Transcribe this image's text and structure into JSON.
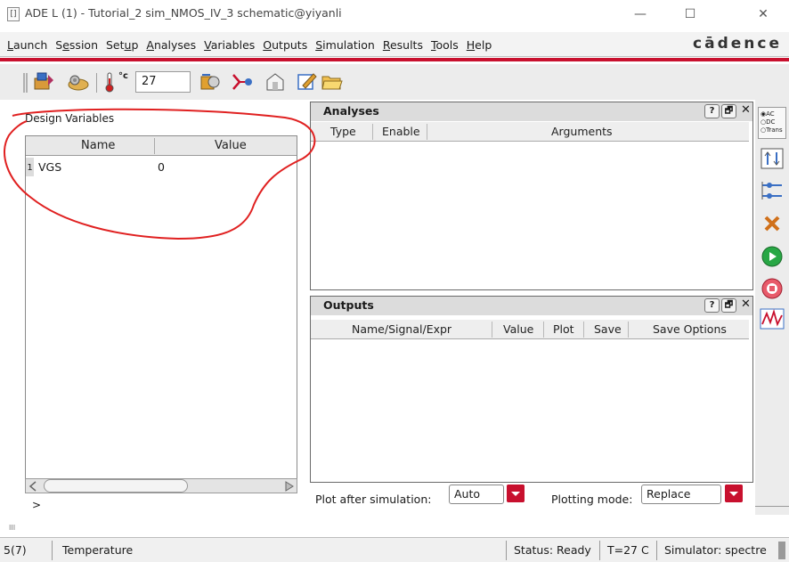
{
  "window": {
    "title": "ADE L (1) - Tutorial_2 sim_NMOS_IV_3 schematic@yiyanli",
    "app_icon_label": "[]",
    "minimize": "—",
    "maximize": "☐",
    "close": "✕"
  },
  "menubar": {
    "items": [
      {
        "u": "L",
        "rest": "aunch"
      },
      {
        "pre": "S",
        "u": "e",
        "rest": "ssion"
      },
      {
        "pre": "Set",
        "u": "u",
        "rest": "p"
      },
      {
        "u": "A",
        "rest": "nalyses"
      },
      {
        "u": "V",
        "rest": "ariables"
      },
      {
        "u": "O",
        "rest": "utputs"
      },
      {
        "u": "S",
        "rest": "imulation"
      },
      {
        "u": "R",
        "rest": "esults"
      },
      {
        "u": "T",
        "rest": "ools"
      },
      {
        "u": "H",
        "rest": "elp"
      }
    ],
    "brand": "cādence"
  },
  "toolbar": {
    "temperature_unit": "°c",
    "temperature_value": "27"
  },
  "design_variables": {
    "label": "Design Variables",
    "columns": [
      "Name",
      "Value"
    ],
    "rows": [
      {
        "index": "1",
        "name": "VGS",
        "value": "0"
      }
    ],
    "prompt": ">"
  },
  "analyses": {
    "title": "Analyses",
    "columns": [
      "Type",
      "Enable",
      "Arguments"
    ]
  },
  "outputs": {
    "title": "Outputs",
    "columns": [
      "Name/Signal/Expr",
      "Value",
      "Plot",
      "Save",
      "Save Options"
    ]
  },
  "panel_buttons": {
    "help": "?",
    "float": "🗗",
    "close": "✕"
  },
  "right_toolbar": {
    "analysis_options": [
      "AC",
      "DC",
      "Trans"
    ]
  },
  "bottom": {
    "plot_after_label": "Plot after simulation:",
    "plot_after_value": "Auto",
    "plotting_mode_label": "Plotting mode:",
    "plotting_mode_value": "Replace"
  },
  "statusbar": {
    "count": "5(7)",
    "message": "Temperature",
    "status": "Status: Ready",
    "temp": "T=27 C",
    "simulator": "Simulator: spectre"
  },
  "colors": {
    "cadence_red": "#c8102e",
    "annotation_red": "#e02020",
    "panel_gray": "#dcdcdc"
  }
}
